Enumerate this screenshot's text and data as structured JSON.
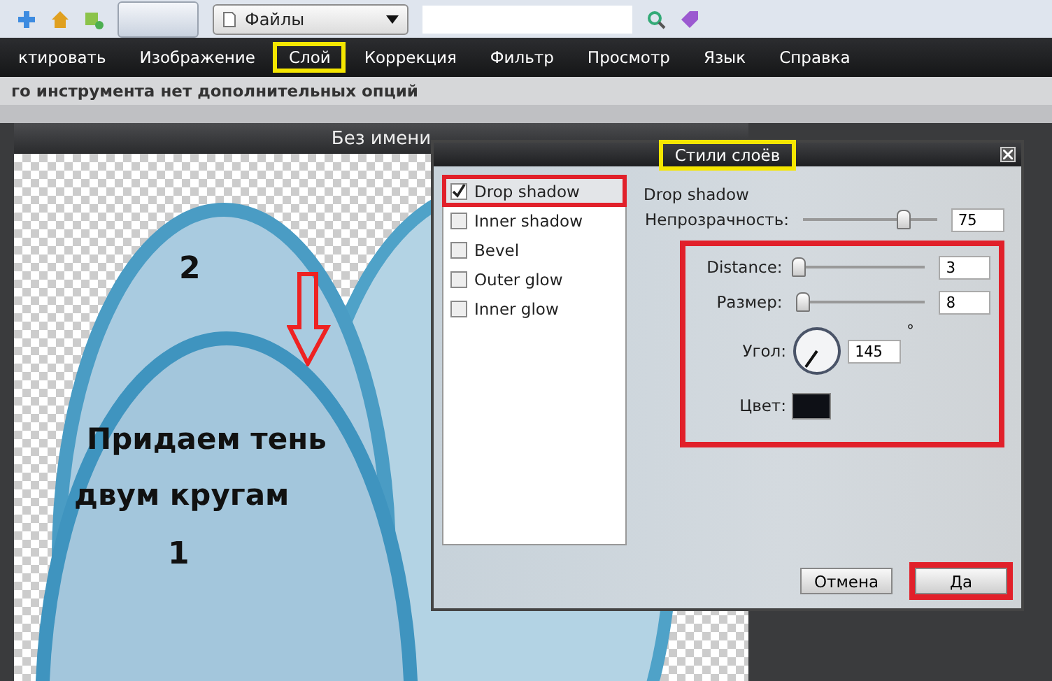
{
  "toolbar": {
    "file_dropdown": "Файлы"
  },
  "menu": [
    {
      "label": "ктировать",
      "highlighted": false
    },
    {
      "label": "Изображение",
      "highlighted": false
    },
    {
      "label": "Слой",
      "highlighted": true
    },
    {
      "label": "Коррекция",
      "highlighted": false
    },
    {
      "label": "Фильтр",
      "highlighted": false
    },
    {
      "label": "Просмотр",
      "highlighted": false
    },
    {
      "label": "Язык",
      "highlighted": false
    },
    {
      "label": "Справка",
      "highlighted": false
    }
  ],
  "options_bar": "го инструмента нет дополнительных опций",
  "document": {
    "title": "Без имени",
    "canvas_texts": [
      {
        "kind": "number",
        "text": "2"
      },
      {
        "kind": "caption",
        "text": "Придаем тень"
      },
      {
        "kind": "caption",
        "text": "двум кругам"
      },
      {
        "kind": "number",
        "text": "1"
      }
    ]
  },
  "dialog": {
    "title": "Стили слоёв",
    "title_highlighted": true,
    "effects": [
      {
        "label": "Drop shadow",
        "checked": true,
        "selected": true,
        "highlighted": true
      },
      {
        "label": "Inner shadow",
        "checked": false,
        "selected": false,
        "highlighted": false
      },
      {
        "label": "Bevel",
        "checked": false,
        "selected": false,
        "highlighted": false
      },
      {
        "label": "Outer glow",
        "checked": false,
        "selected": false,
        "highlighted": false
      },
      {
        "label": "Inner glow",
        "checked": false,
        "selected": false,
        "highlighted": false
      }
    ],
    "section_title": "Drop shadow",
    "opacity": {
      "label": "Непрозрачность:",
      "level": 0.75,
      "value": "75"
    },
    "settings_highlighted": true,
    "settings": [
      {
        "kind": "slider",
        "label": "Distance:",
        "level": 0.02,
        "value": "3"
      },
      {
        "kind": "slider",
        "label": "Размер:",
        "level": 0.05,
        "value": "8"
      },
      {
        "kind": "angle",
        "label": "Угол:",
        "value": "145",
        "unit": "°"
      },
      {
        "kind": "color",
        "label": "Цвет:",
        "color": "#0e1016"
      }
    ],
    "buttons": [
      {
        "label": "Отмена",
        "highlighted": false
      },
      {
        "label": "Да",
        "highlighted": true
      }
    ]
  }
}
